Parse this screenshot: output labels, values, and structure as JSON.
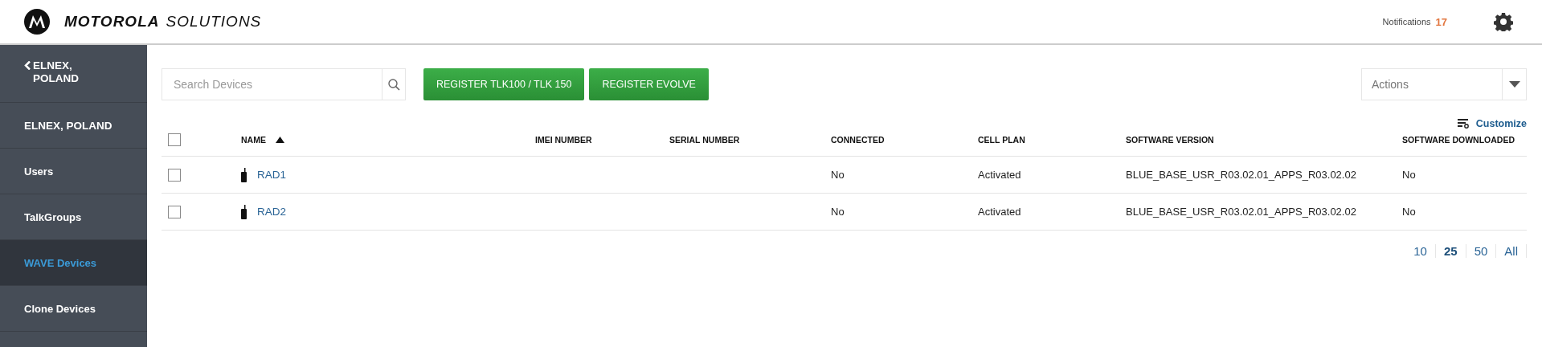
{
  "header": {
    "brand_bold": "MOTOROLA",
    "brand_light": "SOLUTIONS",
    "notifications_label": "Notifications",
    "notifications_count": "17"
  },
  "sidebar": {
    "back": "ELNEX, POLAND",
    "items": [
      {
        "label": "ELNEX, POLAND",
        "selected": false,
        "kind": "caps"
      },
      {
        "label": "Users",
        "selected": false,
        "kind": "plain"
      },
      {
        "label": "TalkGroups",
        "selected": false,
        "kind": "plain"
      },
      {
        "label": "WAVE Devices",
        "selected": true,
        "kind": "plain"
      },
      {
        "label": "Clone Devices",
        "selected": false,
        "kind": "plain"
      }
    ]
  },
  "toolbar": {
    "search": {
      "placeholder": "Search Devices"
    },
    "buttons": [
      "REGISTER TLK100 / TLK 150",
      "REGISTER EVOLVE"
    ],
    "actions": {
      "placeholder": "Actions"
    }
  },
  "customize": "Customize",
  "table": {
    "select_all": {
      "checked": false
    },
    "columns": [
      {
        "label": "NAME",
        "sorted": true
      },
      {
        "label": "IMEI NUMBER",
        "sorted": false
      },
      {
        "label": "SERIAL NUMBER",
        "sorted": false
      },
      {
        "label": "CONNECTED",
        "sorted": false
      },
      {
        "label": "CELL PLAN",
        "sorted": false
      },
      {
        "label": "SOFTWARE VERSION",
        "sorted": false
      },
      {
        "label": "SOFTWARE DOWNLOADED",
        "sorted": false
      }
    ],
    "rows": [
      {
        "checked": false,
        "name": "RAD1",
        "connected": "No",
        "cell_plan": "Activated",
        "software_version": "BLUE_BASE_USR_R03.02.01_APPS_R03.02.02",
        "software_downloaded": "No"
      },
      {
        "checked": false,
        "name": "RAD2",
        "connected": "No",
        "cell_plan": "Activated",
        "software_version": "BLUE_BASE_USR_R03.02.01_APPS_R03.02.02",
        "software_downloaded": "No"
      }
    ]
  },
  "page_sizes": [
    {
      "label": "10",
      "selected": false
    },
    {
      "label": "25",
      "selected": true
    },
    {
      "label": "50",
      "selected": false
    },
    {
      "label": "All",
      "selected": false
    }
  ]
}
